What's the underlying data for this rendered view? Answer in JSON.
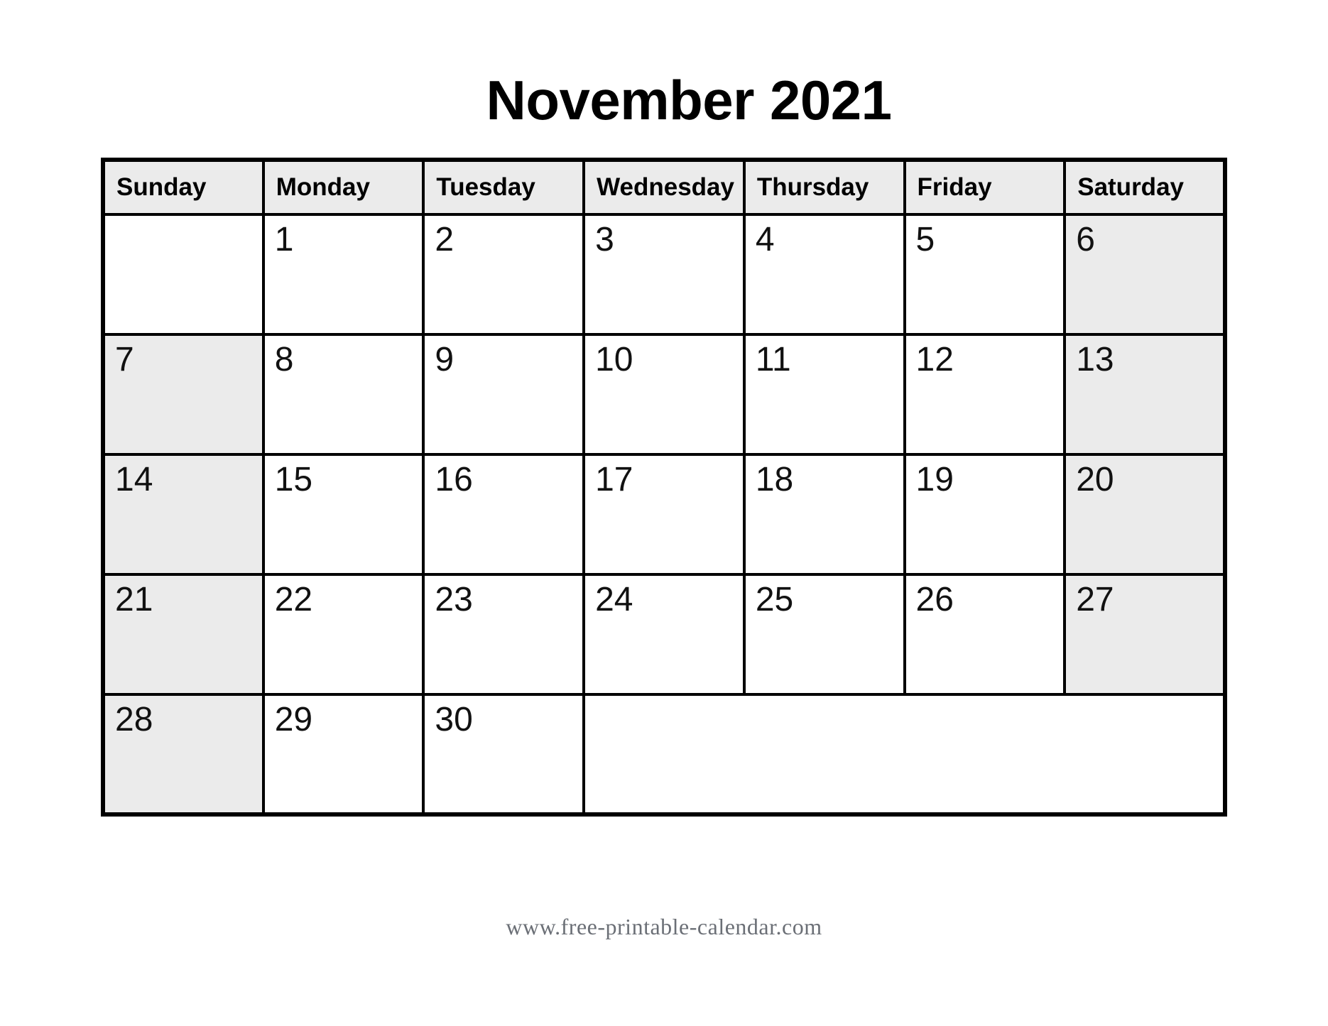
{
  "title": {
    "month": "November",
    "year": "2021",
    "full": "November 2021"
  },
  "colors": {
    "weekend_shade": "#ebebeb",
    "header_shade": "#ebebeb",
    "grid_line": "#000000",
    "text": "#000000",
    "footer_text": "#6b6f76",
    "page_background": "#ffffff"
  },
  "weekdays": [
    "Sunday",
    "Monday",
    "Tuesday",
    "Wednesday",
    "Thursday",
    "Friday",
    "Saturday"
  ],
  "weeks": [
    [
      {
        "day": "",
        "shaded": false,
        "empty": true
      },
      {
        "day": "1",
        "shaded": false,
        "empty": false
      },
      {
        "day": "2",
        "shaded": false,
        "empty": false
      },
      {
        "day": "3",
        "shaded": false,
        "empty": false
      },
      {
        "day": "4",
        "shaded": false,
        "empty": false
      },
      {
        "day": "5",
        "shaded": false,
        "empty": false
      },
      {
        "day": "6",
        "shaded": true,
        "empty": false
      }
    ],
    [
      {
        "day": "7",
        "shaded": true,
        "empty": false
      },
      {
        "day": "8",
        "shaded": false,
        "empty": false
      },
      {
        "day": "9",
        "shaded": false,
        "empty": false
      },
      {
        "day": "10",
        "shaded": false,
        "empty": false
      },
      {
        "day": "11",
        "shaded": false,
        "empty": false
      },
      {
        "day": "12",
        "shaded": false,
        "empty": false
      },
      {
        "day": "13",
        "shaded": true,
        "empty": false
      }
    ],
    [
      {
        "day": "14",
        "shaded": true,
        "empty": false
      },
      {
        "day": "15",
        "shaded": false,
        "empty": false
      },
      {
        "day": "16",
        "shaded": false,
        "empty": false
      },
      {
        "day": "17",
        "shaded": false,
        "empty": false
      },
      {
        "day": "18",
        "shaded": false,
        "empty": false
      },
      {
        "day": "19",
        "shaded": false,
        "empty": false
      },
      {
        "day": "20",
        "shaded": true,
        "empty": false
      }
    ],
    [
      {
        "day": "21",
        "shaded": true,
        "empty": false
      },
      {
        "day": "22",
        "shaded": false,
        "empty": false
      },
      {
        "day": "23",
        "shaded": false,
        "empty": false
      },
      {
        "day": "24",
        "shaded": false,
        "empty": false
      },
      {
        "day": "25",
        "shaded": false,
        "empty": false
      },
      {
        "day": "26",
        "shaded": false,
        "empty": false
      },
      {
        "day": "27",
        "shaded": true,
        "empty": false
      }
    ],
    [
      {
        "day": "28",
        "shaded": true,
        "empty": false
      },
      {
        "day": "29",
        "shaded": false,
        "empty": false
      },
      {
        "day": "30",
        "shaded": false,
        "empty": false
      },
      {
        "day": "",
        "shaded": false,
        "empty": true,
        "colspan": 4
      }
    ]
  ],
  "footer": {
    "url": "www.free-printable-calendar.com"
  }
}
